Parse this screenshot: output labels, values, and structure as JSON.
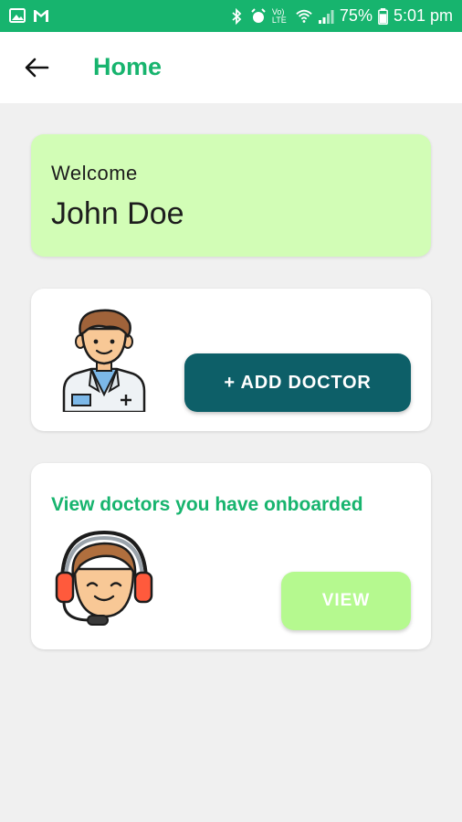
{
  "status_bar": {
    "battery": "75%",
    "time": "5:01 pm",
    "network": "Vo) LTE",
    "icons": [
      "image-icon",
      "gmail-icon",
      "bluetooth-icon",
      "alarm-icon",
      "wifi-icon",
      "signal-icon",
      "battery-icon"
    ]
  },
  "appbar": {
    "title": "Home",
    "back_icon": "back-arrow-icon"
  },
  "welcome": {
    "label": "Welcome",
    "name": "John Doe"
  },
  "add_doctor": {
    "button_label": "+ ADD DOCTOR",
    "illustration": "doctor-icon"
  },
  "onboarded": {
    "title": "View doctors you have onboarded",
    "button_label": "VIEW",
    "illustration": "support-agent-icon"
  },
  "colors": {
    "primary_green": "#17b46e",
    "welcome_bg": "#d2fdb6",
    "add_button": "#0d5f68",
    "view_button": "#b5f98f",
    "background": "#f0f0f0"
  }
}
